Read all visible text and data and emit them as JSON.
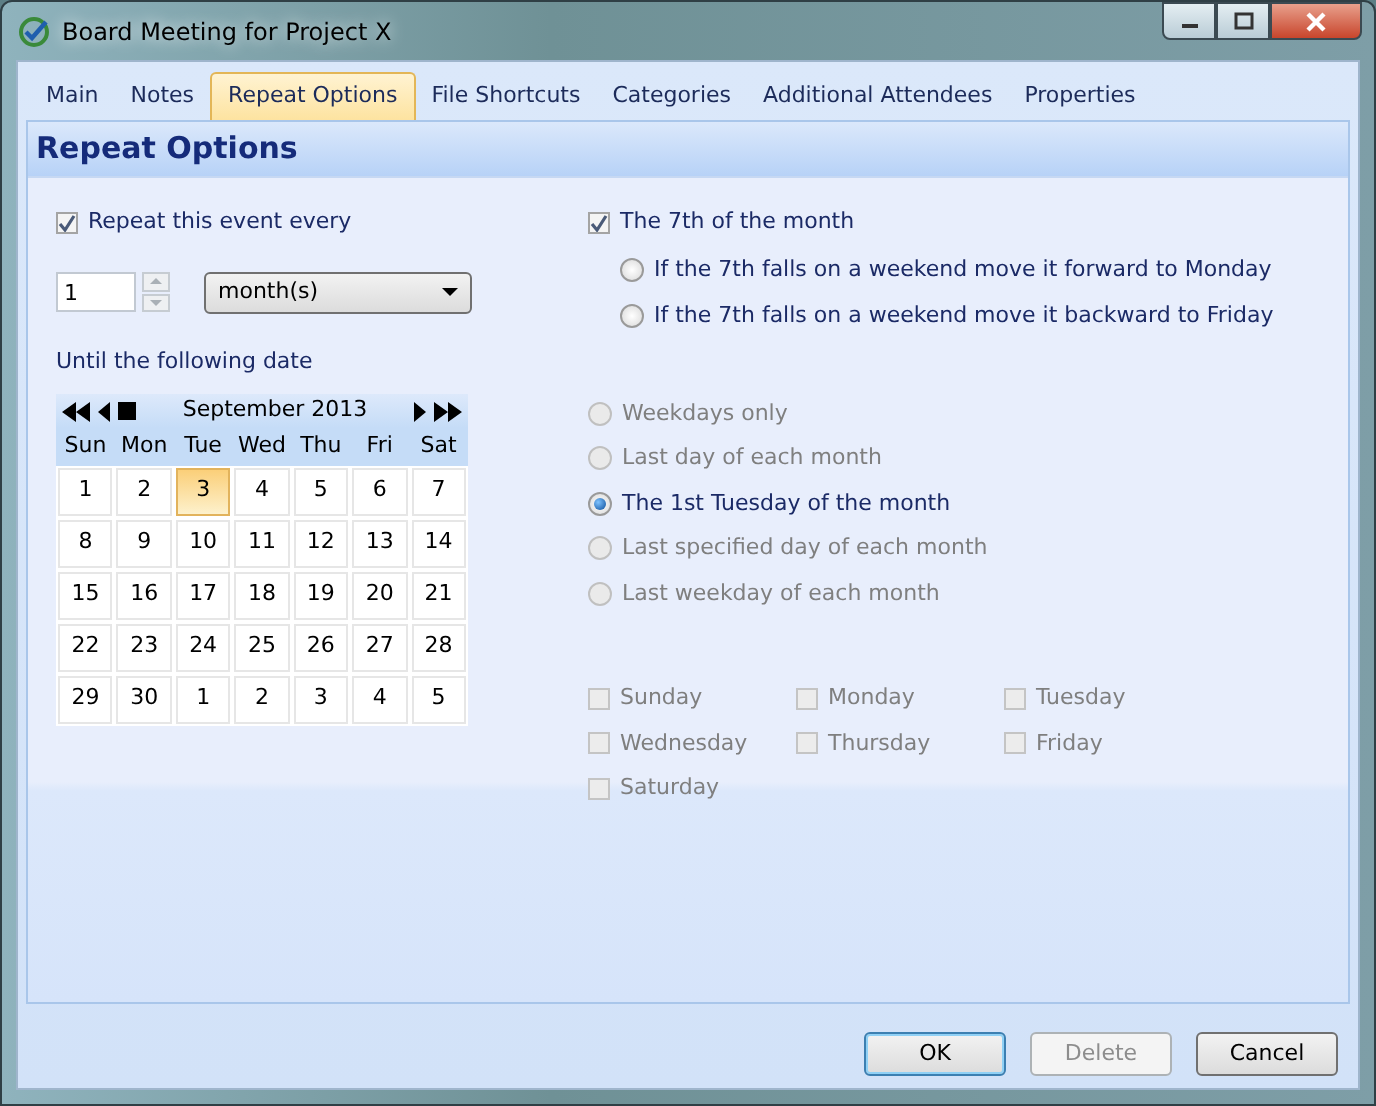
{
  "window": {
    "title": "Board Meeting for Project X"
  },
  "tabs": [
    {
      "label": "Main",
      "selected": false
    },
    {
      "label": "Notes",
      "selected": false
    },
    {
      "label": "Repeat Options",
      "selected": true
    },
    {
      "label": "File Shortcuts",
      "selected": false
    },
    {
      "label": "Categories",
      "selected": false
    },
    {
      "label": "Additional Attendees",
      "selected": false
    },
    {
      "label": "Properties",
      "selected": false
    }
  ],
  "section_title": "Repeat Options",
  "repeat": {
    "label": "Repeat this event every",
    "checked": true,
    "interval": "1",
    "unit": "month(s)"
  },
  "until_label": "Until the following date",
  "calendar": {
    "month": "September 2013",
    "weekdays": [
      "Sun",
      "Mon",
      "Tue",
      "Wed",
      "Thu",
      "Fri",
      "Sat"
    ],
    "weeks": [
      [
        {
          "day": "1",
          "selected": false
        },
        {
          "day": "2",
          "selected": false
        },
        {
          "day": "3",
          "selected": true
        },
        {
          "day": "4",
          "selected": false
        },
        {
          "day": "5",
          "selected": false
        },
        {
          "day": "6",
          "selected": false
        },
        {
          "day": "7",
          "selected": false
        }
      ],
      [
        {
          "day": "8",
          "selected": false
        },
        {
          "day": "9",
          "selected": false
        },
        {
          "day": "10",
          "selected": false
        },
        {
          "day": "11",
          "selected": false
        },
        {
          "day": "12",
          "selected": false
        },
        {
          "day": "13",
          "selected": false
        },
        {
          "day": "14",
          "selected": false
        }
      ],
      [
        {
          "day": "15",
          "selected": false
        },
        {
          "day": "16",
          "selected": false
        },
        {
          "day": "17",
          "selected": false
        },
        {
          "day": "18",
          "selected": false
        },
        {
          "day": "19",
          "selected": false
        },
        {
          "day": "20",
          "selected": false
        },
        {
          "day": "21",
          "selected": false
        }
      ],
      [
        {
          "day": "22",
          "selected": false
        },
        {
          "day": "23",
          "selected": false
        },
        {
          "day": "24",
          "selected": false
        },
        {
          "day": "25",
          "selected": false
        },
        {
          "day": "26",
          "selected": false
        },
        {
          "day": "27",
          "selected": false
        },
        {
          "day": "28",
          "selected": false
        }
      ],
      [
        {
          "day": "29",
          "selected": false
        },
        {
          "day": "30",
          "selected": false
        },
        {
          "day": "1",
          "selected": false
        },
        {
          "day": "2",
          "selected": false
        },
        {
          "day": "3",
          "selected": false
        },
        {
          "day": "4",
          "selected": false
        },
        {
          "day": "5",
          "selected": false
        }
      ]
    ]
  },
  "day_of_month": {
    "label": "The 7th of the month",
    "checked": true,
    "options": [
      {
        "label": "If the 7th falls on a weekend move it forward to Monday",
        "selected": false,
        "disabled": false
      },
      {
        "label": "If the 7th falls on a weekend move it backward to Friday",
        "selected": false,
        "disabled": false
      }
    ]
  },
  "patterns": [
    {
      "label": "Weekdays only",
      "selected": false,
      "disabled": true
    },
    {
      "label": "Last day of each month",
      "selected": false,
      "disabled": true
    },
    {
      "label": "The 1st Tuesday of the month",
      "selected": true,
      "disabled": false
    },
    {
      "label": "Last specified day of each month",
      "selected": false,
      "disabled": true
    },
    {
      "label": "Last weekday of each month",
      "selected": false,
      "disabled": true
    }
  ],
  "days": [
    {
      "label": "Sunday",
      "checked": false,
      "disabled": true
    },
    {
      "label": "Monday",
      "checked": false,
      "disabled": true
    },
    {
      "label": "Tuesday",
      "checked": false,
      "disabled": true
    },
    {
      "label": "Wednesday",
      "checked": false,
      "disabled": true
    },
    {
      "label": "Thursday",
      "checked": false,
      "disabled": true
    },
    {
      "label": "Friday",
      "checked": false,
      "disabled": true
    },
    {
      "label": "Saturday",
      "checked": false,
      "disabled": true
    }
  ],
  "buttons": [
    {
      "label": "OK",
      "disabled": false,
      "default": true
    },
    {
      "label": "Delete",
      "disabled": true,
      "default": false
    },
    {
      "label": "Cancel",
      "disabled": false,
      "default": false
    }
  ]
}
